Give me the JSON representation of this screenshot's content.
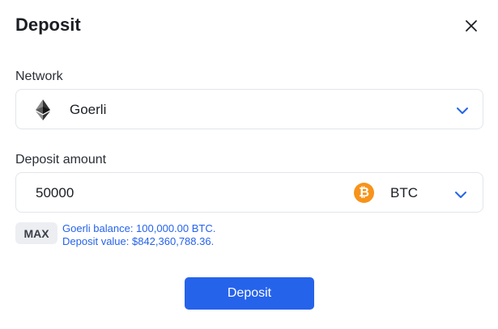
{
  "dialog": {
    "title": "Deposit",
    "close_icon": "close-icon"
  },
  "network": {
    "label": "Network",
    "selected": "Goerli",
    "icon": "ethereum-icon"
  },
  "amount": {
    "label": "Deposit amount",
    "value": "50000",
    "token": "BTC",
    "token_icon": "bitcoin-icon",
    "token_symbol_glyph": "₿"
  },
  "max_button": {
    "label": "MAX"
  },
  "info": {
    "balance": "Goerli balance: 100,000.00 BTC.",
    "deposit_value": "Deposit value: $842,360,788.36."
  },
  "submit": {
    "label": "Deposit"
  },
  "colors": {
    "accent": "#2563eb",
    "bitcoin": "#f7931a",
    "field_border": "#e2e5ea",
    "max_bg": "#eceef2"
  }
}
